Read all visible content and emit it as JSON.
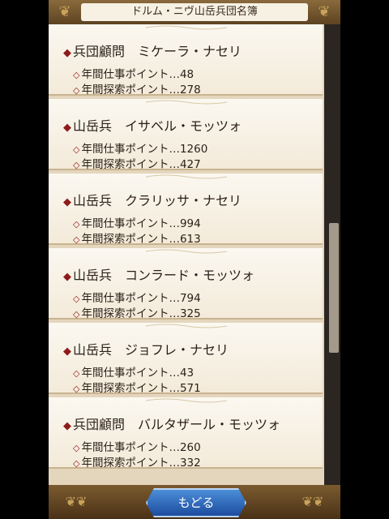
{
  "header": {
    "title": "ドルム・ニヴ山岳兵団名簿"
  },
  "members": [
    {
      "rank": "兵団顧問",
      "name": "ミケーラ・ナセリ",
      "work_label": "年間仕事ポイント…48",
      "explore_label": "年間探索ポイント…278"
    },
    {
      "rank": "山岳兵",
      "name": "イサベル・モッツォ",
      "work_label": "年間仕事ポイント…1260",
      "explore_label": "年間探索ポイント…427"
    },
    {
      "rank": "山岳兵",
      "name": "クラリッサ・ナセリ",
      "work_label": "年間仕事ポイント…994",
      "explore_label": "年間探索ポイント…613"
    },
    {
      "rank": "山岳兵",
      "name": "コンラード・モッツォ",
      "work_label": "年間仕事ポイント…794",
      "explore_label": "年間探索ポイント…325"
    },
    {
      "rank": "山岳兵",
      "name": "ジョフレ・ナセリ",
      "work_label": "年間仕事ポイント…43",
      "explore_label": "年間探索ポイント…571"
    },
    {
      "rank": "兵団顧問",
      "name": "バルタザール・モッツォ",
      "work_label": "年間仕事ポイント…260",
      "explore_label": "年間探索ポイント…332"
    }
  ],
  "footer": {
    "back_label": "もどる"
  },
  "scroll": {
    "position_fraction": 0.6
  },
  "colors": {
    "accent": "#8e1b1b",
    "button": "#2f6cc0"
  }
}
